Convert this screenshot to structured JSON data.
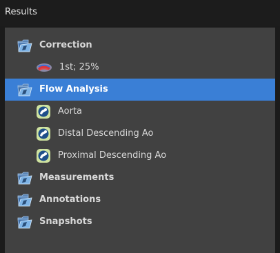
{
  "panel": {
    "title": "Results"
  },
  "tree": [
    {
      "label": "Correction",
      "icon": "folder-icon",
      "bold": true,
      "selected": false,
      "children": [
        {
          "label": "1st; 25%",
          "icon": "correction-icon"
        }
      ]
    },
    {
      "label": "Flow Analysis",
      "icon": "folder-icon",
      "bold": true,
      "selected": true,
      "children": [
        {
          "label": "Aorta",
          "icon": "flow-vessel-icon"
        },
        {
          "label": "Distal Descending Ao",
          "icon": "flow-vessel-icon"
        },
        {
          "label": "Proximal Descending Ao",
          "icon": "flow-vessel-icon"
        }
      ]
    },
    {
      "label": "Measurements",
      "icon": "folder-icon",
      "bold": true,
      "selected": false,
      "children": []
    },
    {
      "label": "Annotations",
      "icon": "folder-icon",
      "bold": true,
      "selected": false,
      "children": []
    },
    {
      "label": "Snapshots",
      "icon": "folder-icon",
      "bold": true,
      "selected": false,
      "children": []
    }
  ],
  "colors": {
    "background": "#414141",
    "header_background": "#1c1c1c",
    "selection": "#3a7fd6",
    "text": "#d8d8d8"
  }
}
